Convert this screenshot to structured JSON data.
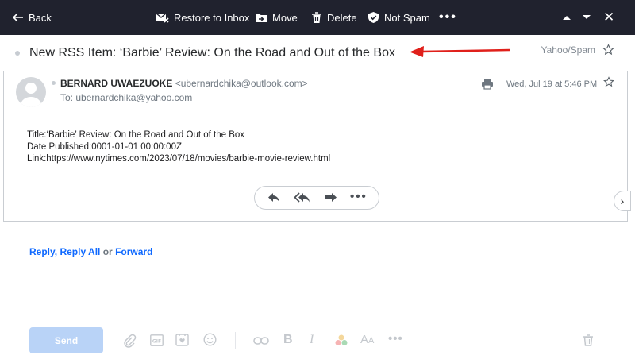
{
  "toolbar": {
    "back_label": "Back",
    "restore_label": "Restore to Inbox",
    "move_label": "Move",
    "delete_label": "Delete",
    "not_spam_label": "Not Spam",
    "more_label": "•••",
    "close_label": "✕"
  },
  "message": {
    "subject": "New RSS Item: ‘Barbie’ Review: On the Road and Out of the Box",
    "folder": "Yahoo/Spam",
    "sender_name": "BERNARD UWAEZUOKE",
    "sender_email": "<ubernardchika@outlook.com>",
    "recipient": "To: ubernardchika@yahoo.com",
    "date": "Wed, Jul 19 at 5:46 PM",
    "body_lines": [
      "Title:‘Barbie’ Review: On the Road and Out of the Box",
      "Date Published:0001-01-01 00:00:00Z",
      "Link:https://www.nytimes.com/2023/07/18/movies/barbie-movie-review.html"
    ],
    "actions_more": "•••",
    "next_label": "›"
  },
  "compose": {
    "reply_label": "Reply",
    "reply_all_label": "Reply All",
    "or_label": "or",
    "forward_label": "Forward",
    "separator": ", ",
    "send_label": "Send",
    "more_label": "•••"
  },
  "colors": {
    "toolbar_bg": "#20222e",
    "link_blue": "#0f69ff",
    "send_disabled": "#b9d3f7",
    "annotation_arrow": "#e0201b"
  }
}
